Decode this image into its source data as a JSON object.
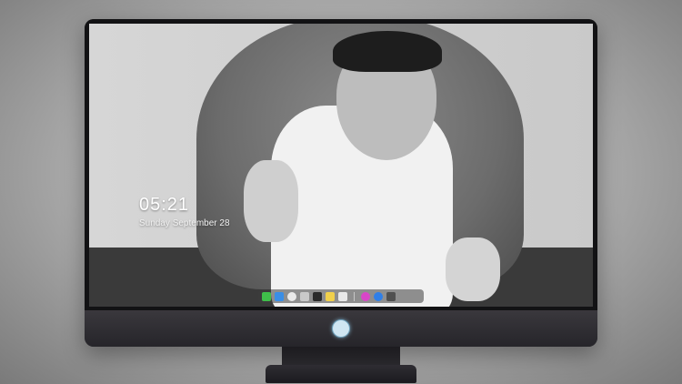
{
  "lockscreen": {
    "time": "05:21",
    "date": "Sunday September 28",
    "subline": ""
  },
  "dock": {
    "apps": [
      {
        "icon": "messages-icon",
        "color": "#3fbf4a"
      },
      {
        "icon": "finder-icon",
        "color": "#3a8ee6"
      },
      {
        "icon": "safari-icon",
        "color": "#e9e9e9"
      },
      {
        "icon": "preview-icon",
        "color": "#c9c9c9"
      },
      {
        "icon": "movie-icon",
        "color": "#2b2b2b"
      },
      {
        "icon": "notes-icon",
        "color": "#f1d04b"
      },
      {
        "icon": "photos-icon",
        "color": "#e8e8e8"
      },
      {
        "icon": "music-icon",
        "color": "#d946c8"
      },
      {
        "icon": "app-store-icon",
        "color": "#2f7fe8"
      },
      {
        "icon": "camera-icon",
        "color": "#505050"
      }
    ]
  }
}
